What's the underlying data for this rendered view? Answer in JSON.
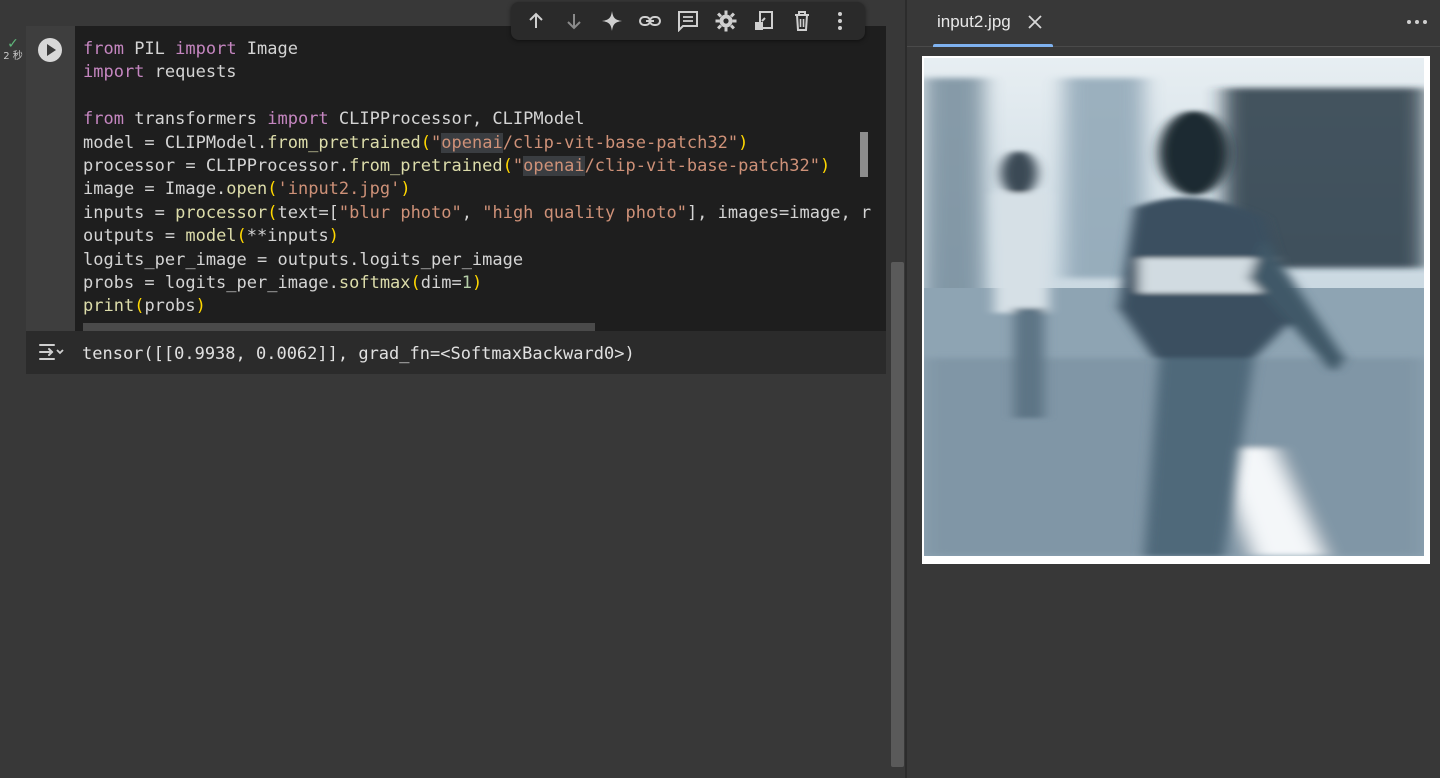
{
  "status": {
    "check": "✓",
    "time": "2 秒"
  },
  "toolbar": {
    "buttons": [
      "arrow-up-icon",
      "arrow-down-icon",
      "sparkle-icon",
      "link-icon",
      "comment-icon",
      "settings-icon",
      "mirror-cell-icon",
      "delete-icon",
      "more-vert-icon"
    ]
  },
  "cell": {
    "code_lines": [
      "from PIL import Image",
      "import requests",
      "",
      "from transformers import CLIPProcessor, CLIPModel",
      "model = CLIPModel.from_pretrained(\"openai/clip-vit-base-patch32\")",
      "processor = CLIPProcessor.from_pretrained(\"openai/clip-vit-base-patch32\")",
      "image = Image.open('input2.jpg')",
      "inputs = processor(text=[\"blur photo\", \"high quality photo\"], images=image, r",
      "outputs = model(**inputs)",
      "logits_per_image = outputs.logits_per_image",
      "probs = logits_per_image.softmax(dim=1)",
      "print(probs)"
    ],
    "output": "tensor([[0.9938, 0.0062]], grad_fn=<SoftmaxBackward0>)"
  },
  "right_panel": {
    "tab_label": "input2.jpg",
    "image_alt": "input2.jpg"
  },
  "colors": {
    "keyword": "#c586c0",
    "function": "#dcdcaa",
    "string": "#ce9178",
    "number": "#b5cea8",
    "bracket": "#ffd700",
    "tab_accent": "#7fb2f0"
  }
}
